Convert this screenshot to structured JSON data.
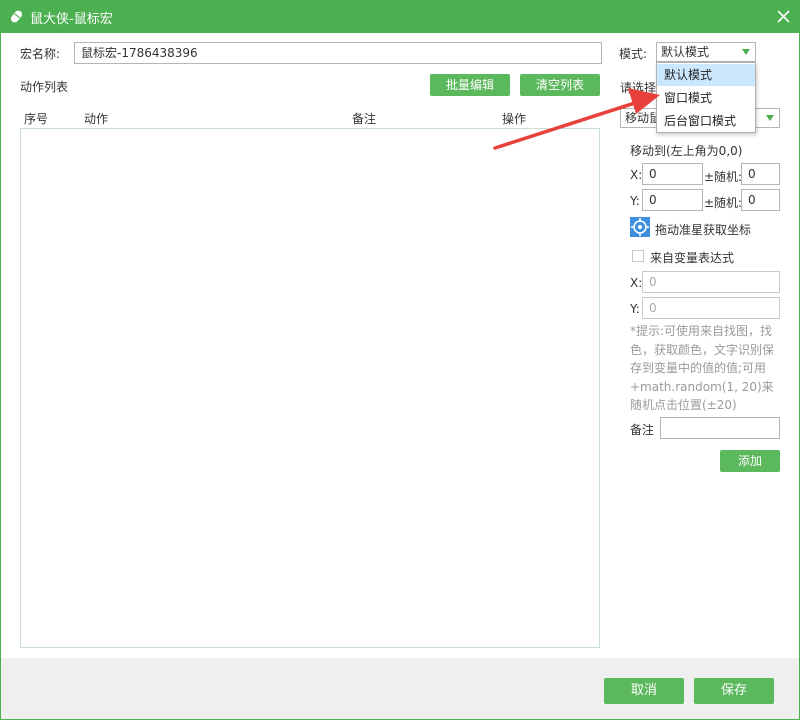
{
  "window": {
    "title": "鼠大侠-鼠标宏",
    "close": "✕"
  },
  "macro": {
    "name_label": "宏名称:",
    "name_value": "鼠标宏-1786438396"
  },
  "mode": {
    "label": "模式:",
    "selected": "默认模式",
    "options": [
      "默认模式",
      "窗口模式",
      "后台窗口模式"
    ]
  },
  "action_list": {
    "title": "动作列表",
    "batch_edit": "批量编辑",
    "clear": "清空列表",
    "columns": [
      "序号",
      "动作",
      "备注",
      "操作"
    ]
  },
  "right_panel": {
    "choose_label": "请选择",
    "action_select": "移动鼠",
    "move_to_label": "移动到(左上角为0,0)",
    "x_label": "X:",
    "y_label": "Y:",
    "x_value": "0",
    "y_value": "0",
    "random_label": "±随机:",
    "random_x": "0",
    "random_y": "0",
    "drag_label": "拖动准星获取坐标",
    "from_var_label": "来自变量表达式",
    "var_x_placeholder": "0",
    "var_y_placeholder": "0",
    "hint": "*提示:可使用来自找图，找色，获取颜色，文字识别保存到变量中的值的值;可用+math.random(1, 20)来随机点击位置(±20)",
    "note_label": "备注",
    "add_button": "添加"
  },
  "footer": {
    "cancel": "取消",
    "save": "保存"
  },
  "colors": {
    "accent": "#4caf50",
    "button": "#5cb85c",
    "arrow": "#e8413c",
    "selected_option": "#cce8ff"
  }
}
